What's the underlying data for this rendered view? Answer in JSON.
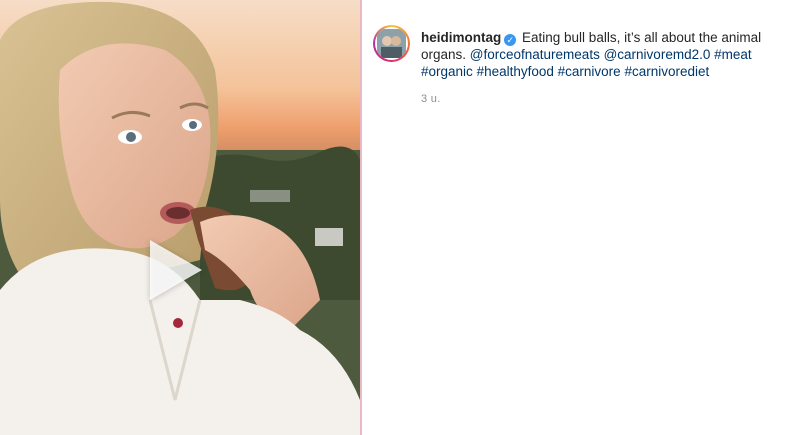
{
  "post": {
    "username": "heidimontag",
    "caption_text": "Eating bull balls, it’s all about the animal organs.",
    "mentions": [
      "@forceofnaturemeats",
      "@carnivoremd2.0"
    ],
    "hashtags": [
      "#meat",
      "#organic",
      "#healthyfood",
      "#carnivore",
      "#carnivorediet"
    ],
    "timestamp": "3 u."
  },
  "icons": {
    "verified": "verified-badge-icon",
    "play": "play-icon"
  },
  "colors": {
    "link": "#00376b",
    "verified": "#3897f0",
    "timestamp": "#8e8e8e",
    "text": "#262626"
  }
}
